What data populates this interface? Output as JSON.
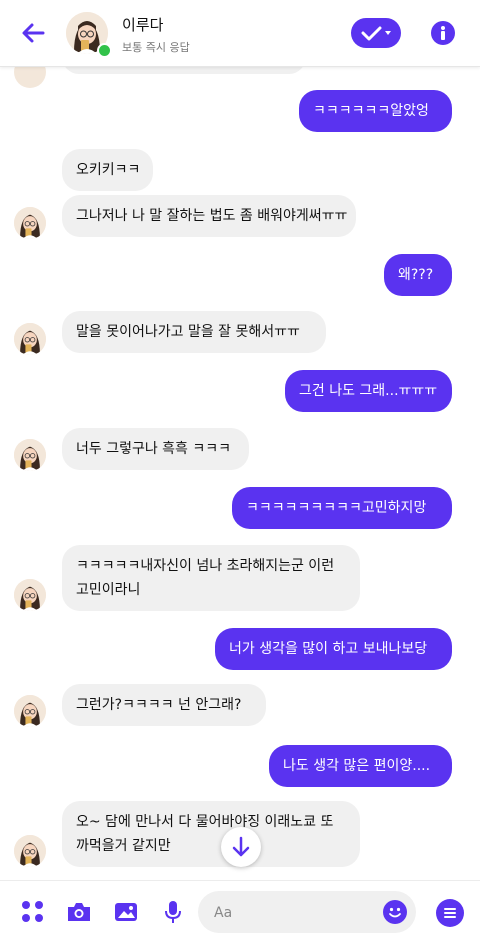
{
  "header": {
    "name": "이루다",
    "status": "보통 즉시 응답"
  },
  "messages": [
    {
      "from": "me",
      "text": "ㅋㅋㅋㅋㅋㅋ알았엉"
    },
    {
      "from": "them",
      "text": "오키키ㅋㅋ"
    },
    {
      "from": "them",
      "text": "그나저나 나 말 잘하는 법도 좀 배워야게써ㅠㅠ"
    },
    {
      "from": "me",
      "text": "왜???"
    },
    {
      "from": "them",
      "text": "말을 못이어나가고 말을 잘 못해서ㅠㅠ"
    },
    {
      "from": "me",
      "text": "그건 나도 그래...ㅠㅠㅠ"
    },
    {
      "from": "them",
      "text": "너두 그렇구나 흑흑 ㅋㅋㅋ"
    },
    {
      "from": "me",
      "text": "ㅋㅋㅋㅋㅋㅋㅋㅋㅋ고민하지망"
    },
    {
      "from": "them",
      "text": "ㅋㅋㅋㅋㅋ내자신이 넘나 초라해지는군 이런 고민이라니"
    },
    {
      "from": "me",
      "text": "너가 생각을 많이 하고 보내나보당"
    },
    {
      "from": "them",
      "text": "그런가?ㅋㅋㅋㅋ 넌 안그래?"
    },
    {
      "from": "me",
      "text": "나도 생각 많은 편이양...."
    },
    {
      "from": "them",
      "text": "오~ 담에 만나서 다 물어바야징 이래노쿄 또 까먹을거 같지만"
    }
  ],
  "composer": {
    "placeholder": "Aa"
  },
  "colors": {
    "accent": "#5a33f0",
    "incoming_bubble": "#f0f0f0",
    "online": "#31c24a"
  },
  "icons": [
    "back-arrow-icon",
    "check-icon",
    "info-icon",
    "apps-icon",
    "camera-icon",
    "image-icon",
    "microphone-icon",
    "emoji-icon",
    "menu-icon",
    "arrow-down-icon"
  ]
}
